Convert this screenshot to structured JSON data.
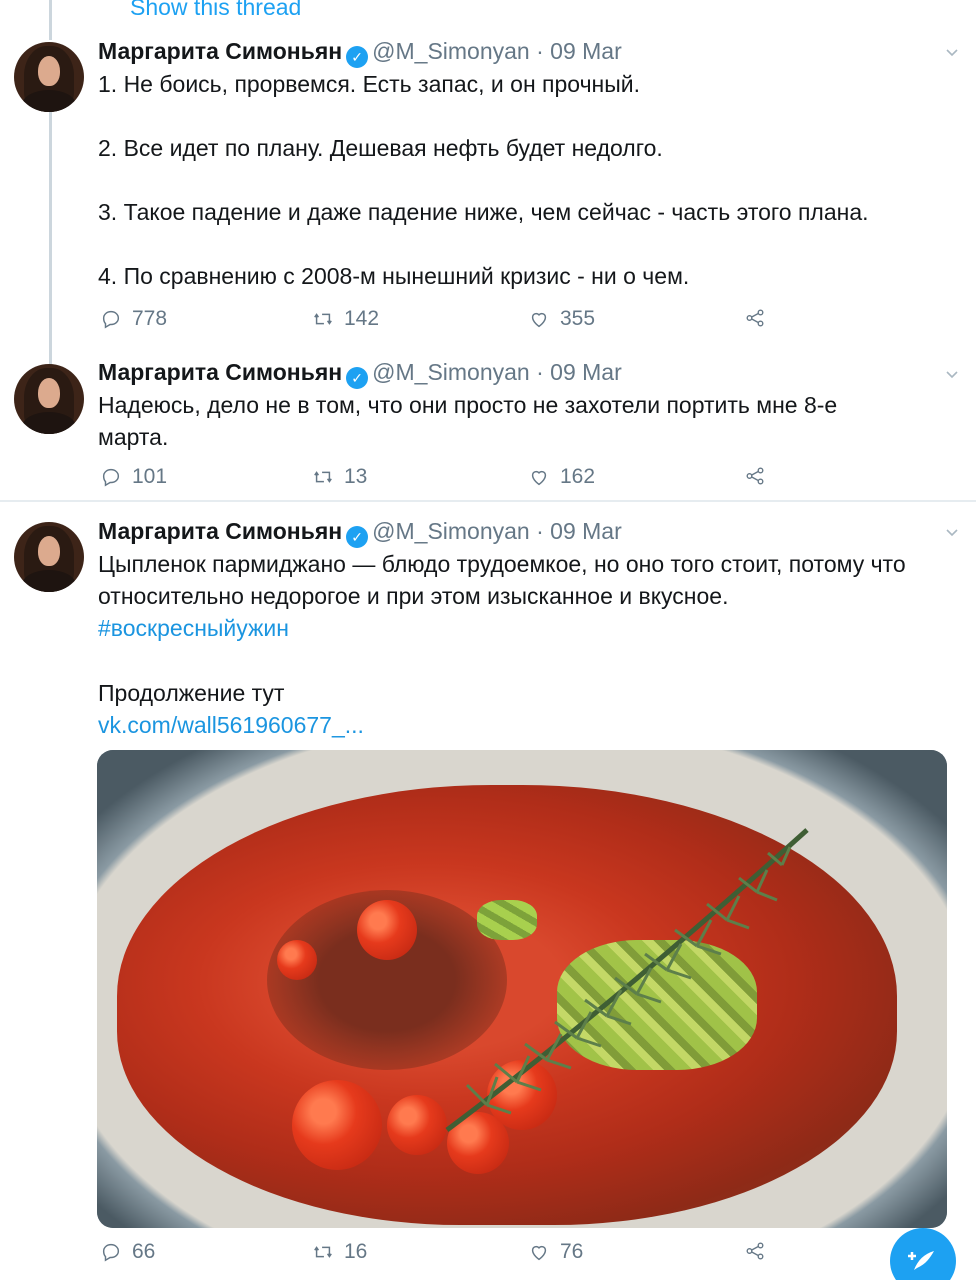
{
  "show_thread": "Show this thread",
  "tweets": [
    {
      "name": "Маргарита Симоньян",
      "handle": "@M_Simonyan",
      "separator": "·",
      "date": "09 Mar",
      "text": "1. Не боись, прорвемся. Есть запас, и он прочный.\n\n2. Все идет по плану. Дешевая нефть будет недолго.\n\n3. Такое падение и даже падение ниже, чем сейчас - часть этого плана.\n\n4. По сравнению с 2008-м нынешний кризис - ни о чем.",
      "replies": "778",
      "retweets": "142",
      "likes": "355"
    },
    {
      "name": "Маргарита Симоньян",
      "handle": "@M_Simonyan",
      "separator": "·",
      "date": "09 Mar",
      "text": "Надеюсь, дело не в том, что они просто не захотели портить мне 8-е марта.",
      "replies": "101",
      "retweets": "13",
      "likes": "162"
    },
    {
      "name": "Маргарита Симоньян",
      "handle": "@M_Simonyan",
      "separator": "·",
      "date": "09 Mar",
      "text": "Цыпленок пармиджано — блюдо трудоемкое, но оно того стоит, потому что относительно недорогое и при этом изысканное и вкусное.",
      "hashtag": "#воскресныйужин",
      "continue_text": "Продолжение тут",
      "link": "vk.com/wall561960677_...",
      "replies": "66",
      "retweets": "16",
      "likes": "76"
    }
  ],
  "icons": {
    "reply": "reply-icon",
    "retweet": "retweet-icon",
    "like": "heart-icon",
    "share": "share-icon",
    "compose": "compose-tweet-icon"
  },
  "colors": {
    "accent": "#1da1f2",
    "link": "#1b95e0",
    "muted": "#657786"
  }
}
